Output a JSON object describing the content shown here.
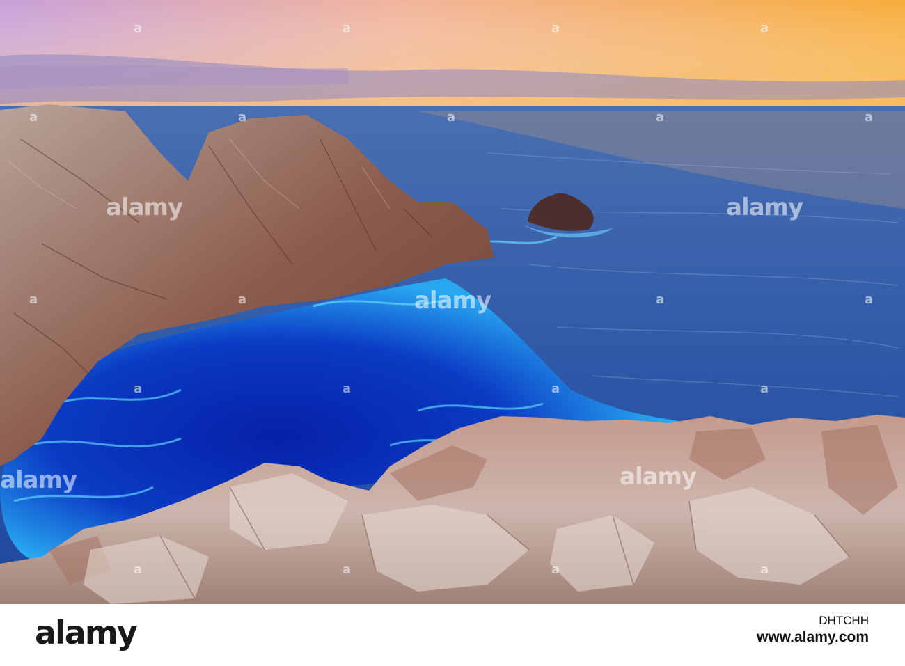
{
  "photo": {
    "alt": "Cliffs and sea at sunset",
    "colors": {
      "sky_top": "#c9a3d9",
      "sky_bottom": "#f6b24a",
      "sea_far": "#3b64a6",
      "sea_near": "#0d2fb0",
      "foam": "#3ec8ff",
      "rock": "#9c7566",
      "rock_light": "#d8c2b7"
    }
  },
  "watermark": {
    "word": "alamy",
    "glyph": "a"
  },
  "footer": {
    "brand": "alamy",
    "image_id": "DHTCHH",
    "url": "www.alamy.com"
  }
}
